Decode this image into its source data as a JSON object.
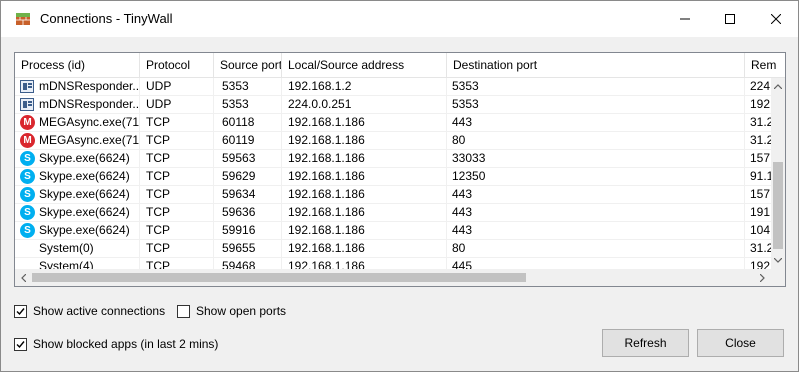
{
  "window": {
    "title": "Connections - TinyWall"
  },
  "icons": {
    "app": "tinywall-app-icon",
    "minimize": "minimize-icon",
    "maximize": "maximize-icon",
    "close": "close-icon",
    "generic_process": "application-icon",
    "mega": "mega-icon",
    "skype": "skype-icon"
  },
  "table": {
    "columns": [
      "Process (id)",
      "Protocol",
      "Source port",
      "Local/Source address",
      "Destination port",
      "Rem"
    ],
    "rows": [
      {
        "icon": "doc",
        "process": "mDNSResponder....",
        "protocol": "UDP",
        "source_port": "5353",
        "local_address": "192.168.1.2",
        "destination_port": "5353",
        "remote": "224"
      },
      {
        "icon": "doc",
        "process": "mDNSResponder....",
        "protocol": "UDP",
        "source_port": "5353",
        "local_address": "224.0.0.251",
        "destination_port": "5353",
        "remote": "192"
      },
      {
        "icon": "mega",
        "process": "MEGAsync.exe(71...",
        "protocol": "TCP",
        "source_port": "60118",
        "local_address": "192.168.1.186",
        "destination_port": "443",
        "remote": "31.2"
      },
      {
        "icon": "mega",
        "process": "MEGAsync.exe(71...",
        "protocol": "TCP",
        "source_port": "60119",
        "local_address": "192.168.1.186",
        "destination_port": "80",
        "remote": "31.2"
      },
      {
        "icon": "skype",
        "process": "Skype.exe(6624)",
        "protocol": "TCP",
        "source_port": "59563",
        "local_address": "192.168.1.186",
        "destination_port": "33033",
        "remote": "157"
      },
      {
        "icon": "skype",
        "process": "Skype.exe(6624)",
        "protocol": "TCP",
        "source_port": "59629",
        "local_address": "192.168.1.186",
        "destination_port": "12350",
        "remote": "91.1"
      },
      {
        "icon": "skype",
        "process": "Skype.exe(6624)",
        "protocol": "TCP",
        "source_port": "59634",
        "local_address": "192.168.1.186",
        "destination_port": "443",
        "remote": "157"
      },
      {
        "icon": "skype",
        "process": "Skype.exe(6624)",
        "protocol": "TCP",
        "source_port": "59636",
        "local_address": "192.168.1.186",
        "destination_port": "443",
        "remote": "191"
      },
      {
        "icon": "skype",
        "process": "Skype.exe(6624)",
        "protocol": "TCP",
        "source_port": "59916",
        "local_address": "192.168.1.186",
        "destination_port": "443",
        "remote": "104"
      },
      {
        "icon": "none",
        "process": "System(0)",
        "protocol": "TCP",
        "source_port": "59655",
        "local_address": "192.168.1.186",
        "destination_port": "80",
        "remote": "31.2"
      },
      {
        "icon": "none",
        "process": "System(4)",
        "protocol": "TCP",
        "source_port": "59468",
        "local_address": "192.168.1.186",
        "destination_port": "445",
        "remote": "192"
      }
    ]
  },
  "options": {
    "show_active": {
      "label": "Show active connections",
      "checked": true
    },
    "show_open_ports": {
      "label": "Show open ports",
      "checked": false
    },
    "show_blocked": {
      "label": "Show blocked apps (in last 2 mins)",
      "checked": true
    }
  },
  "buttons": {
    "refresh": "Refresh",
    "close": "Close"
  }
}
